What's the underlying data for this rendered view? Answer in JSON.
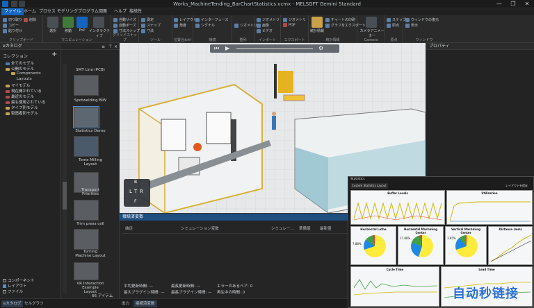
{
  "window": {
    "title": "Works_MachineTending_BarChartStatistics.vcmx - MELSOFT Gemini Standard",
    "minimize": "—",
    "maximize": "❐",
    "close": "✕"
  },
  "tabs": [
    {
      "label": "ファイル",
      "active": true
    },
    {
      "label": "ホーム"
    },
    {
      "label": "プロセス"
    },
    {
      "label": "モデリング"
    },
    {
      "label": "プログラム"
    },
    {
      "label": "図面"
    },
    {
      "label": "ヘルプ"
    },
    {
      "label": "接続性"
    }
  ],
  "ribbon": {
    "groups": [
      {
        "label": "クリップボード",
        "items": [
          "切り取り",
          "コピー",
          "貼り付け",
          "削除"
        ]
      },
      {
        "label": "マニピュレーション",
        "items": [
          "選択",
          "移動",
          "PnP",
          "インタラクティブ"
        ]
      },
      {
        "label": "グリッドスナップ",
        "items": [
          "自動サイズ",
          "自動ポーズ",
          "寸法スナップ"
        ]
      },
      {
        "label": "ツール",
        "items": [
          "測定",
          "スナップ",
          "寸法"
        ]
      },
      {
        "label": "位置合わせ",
        "items": [
          "レイアウト",
          "角度"
        ]
      },
      {
        "label": "接続",
        "items": [
          "インターフェース",
          "シグナル"
        ]
      },
      {
        "label": "整列",
        "items": [
          "ジオメトリ"
        ]
      },
      {
        "label": "インポート",
        "items": [
          "ジオメトリ",
          "画像",
          "ビデオ"
        ]
      },
      {
        "label": "エクスポート",
        "items": [
          "ジオメトリ",
          "PDF"
        ]
      },
      {
        "label": "統計情報",
        "items": [
          "統計情報",
          "チャートの印刷",
          "グラフをエクスポート"
        ]
      },
      {
        "label": "Camera",
        "items": [
          "カメラアニメーター"
        ]
      },
      {
        "label": "原点",
        "items": [
          "ステップ",
          "原点"
        ]
      },
      {
        "label": "ウィンドウ",
        "items": [
          "ウィンドウの復元",
          "表示"
        ]
      }
    ]
  },
  "left_panel": {
    "title": "eカタログ",
    "section": "コレクション",
    "tree": [
      {
        "label": "全てのモデル",
        "indent": 1
      },
      {
        "label": "公開のモデル",
        "indent": 1
      },
      {
        "label": "Components",
        "indent": 2
      },
      {
        "label": "Layouts",
        "indent": 2
      },
      {
        "label": "マイモデル",
        "indent": 1
      },
      {
        "label": "現在開かれている",
        "indent": 1
      },
      {
        "label": "最近のモデル",
        "indent": 1
      },
      {
        "label": "最も使用されている",
        "indent": 1
      },
      {
        "label": "タイプ別モデル",
        "indent": 1
      },
      {
        "label": "製造者別モデル",
        "indent": 1
      }
    ],
    "checkboxes": [
      {
        "label": "コンポーネント",
        "checked": false
      },
      {
        "label": "レイアウト",
        "checked": true
      },
      {
        "label": "ファイル",
        "checked": false
      }
    ]
  },
  "catalog": {
    "items": [
      {
        "label": "SMT Line (PCB)"
      },
      {
        "label": "Spotwelding BIW"
      },
      {
        "label": "Statistics Demo",
        "selected": true
      },
      {
        "label": "Tome Milling Layout"
      },
      {
        "label": "Transport Priorities"
      },
      {
        "label": "Trim press cell"
      },
      {
        "label": "Turning Machine Layout"
      },
      {
        "label": "VR Interaction Example Layout"
      }
    ],
    "count": "66 アイテム"
  },
  "properties": {
    "title": "プロパティ"
  },
  "variables": {
    "title": "接続済変数",
    "columns": [
      "端足",
      "シミュレーション変数",
      "シミュレー…",
      "準備値",
      "最新値"
    ],
    "stats": [
      {
        "label": "平均更新時間:",
        "value": "—"
      },
      {
        "label": "最長更新時間:",
        "value": "—"
      },
      {
        "label": "エラーのあるペア:",
        "value": "0"
      },
      {
        "label": "最大ブラグイン時間:",
        "value": "—"
      },
      {
        "label": "最長ブラグイン時間:",
        "value": "—"
      },
      {
        "label": "再生中の時間:",
        "value": "0"
      }
    ]
  },
  "bottom_tabs": [
    {
      "label": "eカタログ",
      "active": true
    },
    {
      "label": "セルグラフ"
    },
    {
      "label": "出力"
    },
    {
      "label": "接続済変数",
      "active": true
    }
  ],
  "statistics_window": {
    "title": "Statistics",
    "tab": "Custom Statistics Layout",
    "layout_button": "レイアウトを保存",
    "charts": [
      {
        "title": "Buffer Levels"
      },
      {
        "title": "Utilization"
      },
      {
        "title": "Horizontal Lathe",
        "pct": "7.88%"
      },
      {
        "title": "Horizontal Machining Center",
        "pct": "17.88%"
      },
      {
        "title": "Vertical Machining Center",
        "pct": "3.85%"
      },
      {
        "title": "Distance (mm)"
      },
      {
        "title": "Cycle Time"
      },
      {
        "title": "Lead Time"
      }
    ],
    "legend": [
      "Busy",
      "Idle",
      "Blocked",
      "Failed"
    ]
  },
  "watermark": "自动秒链接",
  "colors": {
    "accent": "#1565c0",
    "viewport_bg": "#e6e8ea",
    "cell_frame": "#d9b03a"
  }
}
